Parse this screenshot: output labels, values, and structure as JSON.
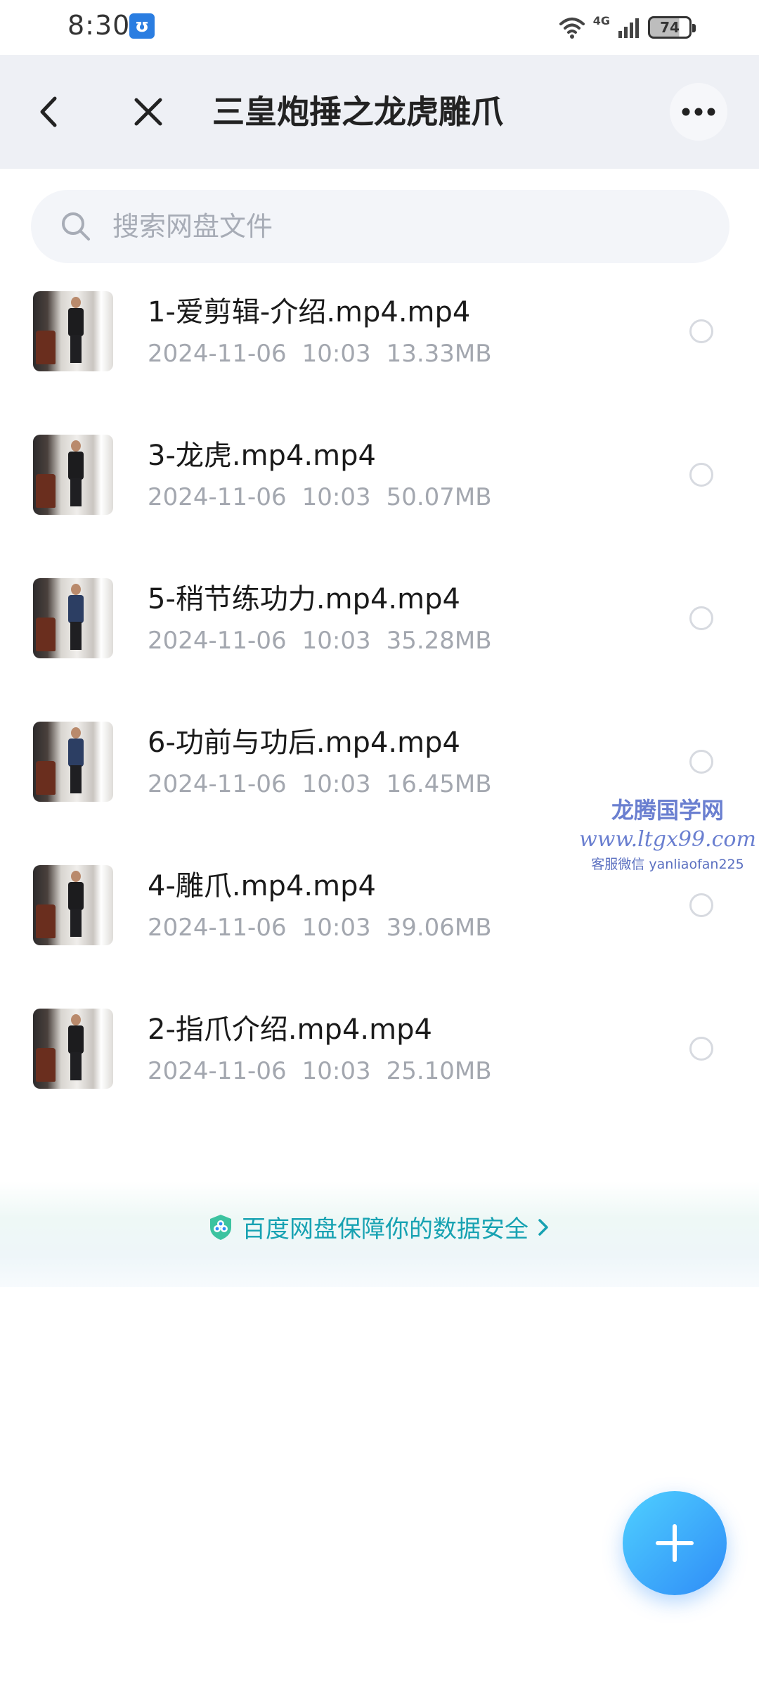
{
  "status_bar": {
    "time": "8:30",
    "network": "4G",
    "battery_level": "74"
  },
  "header": {
    "title": "三皇炮捶之龙虎雕爪"
  },
  "search": {
    "placeholder": "搜索网盘文件"
  },
  "files": [
    {
      "name": "1-爱剪辑-介绍.mp4.mp4",
      "date": "2024-11-06",
      "time": "10:03",
      "size": "13.33MB"
    },
    {
      "name": "3-龙虎.mp4.mp4",
      "date": "2024-11-06",
      "time": "10:03",
      "size": "50.07MB"
    },
    {
      "name": "5-稍节练功力.mp4.mp4",
      "date": "2024-11-06",
      "time": "10:03",
      "size": "35.28MB"
    },
    {
      "name": "6-功前与功后.mp4.mp4",
      "date": "2024-11-06",
      "time": "10:03",
      "size": "16.45MB"
    },
    {
      "name": "4-雕爪.mp4.mp4",
      "date": "2024-11-06",
      "time": "10:03",
      "size": "39.06MB"
    },
    {
      "name": "2-指爪介绍.mp4.mp4",
      "date": "2024-11-06",
      "time": "10:03",
      "size": "25.10MB"
    }
  ],
  "watermark": {
    "title": "龙腾国学网",
    "url": "www.ltgx99.com",
    "contact": "客服微信 yanliaofan225"
  },
  "safety_banner": {
    "text": "百度网盘保障你的数据安全"
  },
  "colors": {
    "accent": "#2f8cf7",
    "safety_text": "#17a2b2",
    "header_bg": "#eef0f5"
  }
}
